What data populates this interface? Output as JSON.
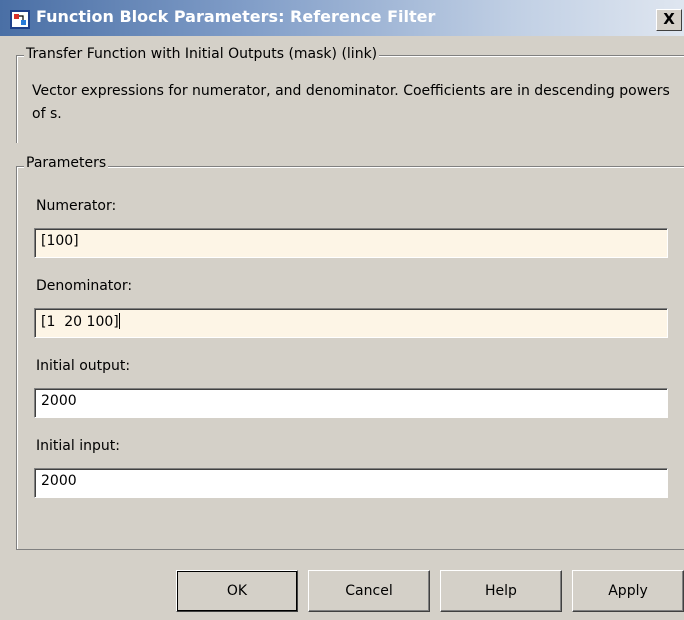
{
  "window": {
    "title": "Function Block Parameters: Reference Filter",
    "close_label": "X",
    "icon": "simulink-block-icon"
  },
  "mask": {
    "group_title": "Transfer Function with Initial Outputs (mask) (link)",
    "description": "Vector expressions for numerator, and denominator. Coefficients are in descending powers of s."
  },
  "parameters": {
    "group_title": "Parameters",
    "numerator": {
      "label": "Numerator:",
      "value": "[100]"
    },
    "denominator": {
      "label": "Denominator:",
      "value": "[1  20 100]"
    },
    "initial_output": {
      "label": "Initial output:",
      "value": "2000"
    },
    "initial_input": {
      "label": "Initial input:",
      "value": "2000"
    }
  },
  "buttons": {
    "ok": "OK",
    "cancel": "Cancel",
    "help": "Help",
    "apply": "Apply"
  },
  "colors": {
    "edited_field": "#fdf5e6",
    "dialog_bg": "#d4d0c8"
  }
}
